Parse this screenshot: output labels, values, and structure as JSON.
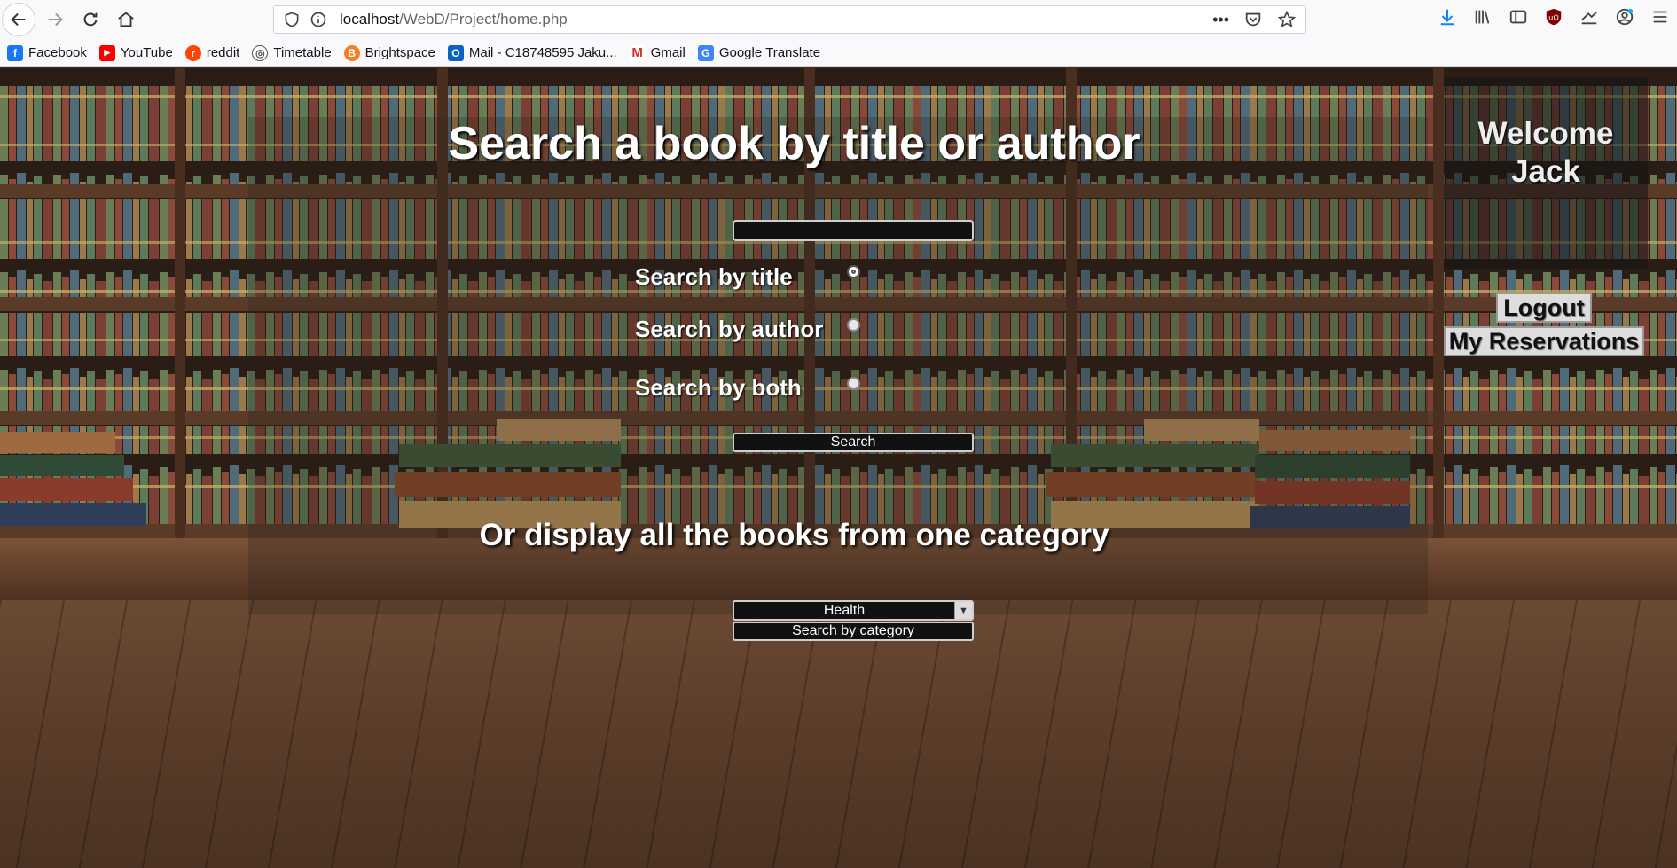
{
  "browser": {
    "url_host": "localhost",
    "url_path": "/WebD/Project/home.php",
    "bookmarks": [
      {
        "label": "Facebook",
        "icon": "facebook-icon",
        "color": "#1877f2",
        "glyph": "f"
      },
      {
        "label": "YouTube",
        "icon": "youtube-icon",
        "color": "#ff0000",
        "glyph": "▶"
      },
      {
        "label": "reddit",
        "icon": "reddit-icon",
        "color": "#ff4500",
        "glyph": "r"
      },
      {
        "label": "Timetable",
        "icon": "globe-icon",
        "color": "#555555",
        "glyph": "◎"
      },
      {
        "label": "Brightspace",
        "icon": "brightspace-icon",
        "color": "#f48024",
        "glyph": "B"
      },
      {
        "label": "Mail - C18748595 Jaku...",
        "icon": "outlook-icon",
        "color": "#0a64c8",
        "glyph": "O"
      },
      {
        "label": "Gmail",
        "icon": "gmail-icon",
        "color": "#d93025",
        "glyph": "M"
      },
      {
        "label": "Google Translate",
        "icon": "translate-icon",
        "color": "#4285f4",
        "glyph": "G"
      }
    ]
  },
  "page": {
    "title": "Search a book by title or author",
    "search_input_value": "",
    "radios": [
      {
        "label": "Search by title"
      },
      {
        "label": "Search by author"
      },
      {
        "label": "Search by both"
      }
    ],
    "search_button": "Search",
    "category_heading": "Or display all the books from one category",
    "category_selected": "Health",
    "category_button": "Search by category"
  },
  "user": {
    "welcome_line1": "Welcome",
    "welcome_line2": "Jack",
    "logout": "Logout",
    "reservations": "My Reservations"
  }
}
